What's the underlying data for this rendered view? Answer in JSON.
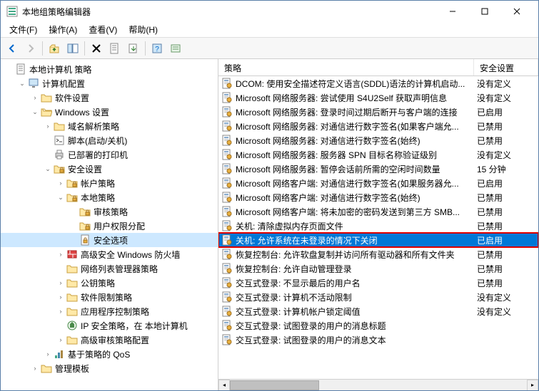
{
  "window": {
    "title": "本地组策略编辑器"
  },
  "menu": {
    "file": "文件(F)",
    "action": "操作(A)",
    "view": "查看(V)",
    "help": "帮助(H)"
  },
  "tree": {
    "root": "本地计算机 策略",
    "computer_config": "计算机配置",
    "software": "软件设置",
    "windows": "Windows 设置",
    "dns": "域名解析策略",
    "scripts": "脚本(启动/关机)",
    "printers": "已部署的打印机",
    "security": "安全设置",
    "account": "帐户策略",
    "local": "本地策略",
    "audit": "审核策略",
    "rights": "用户权限分配",
    "options": "安全选项",
    "firewall": "高级安全 Windows 防火墙",
    "netlist": "网络列表管理器策略",
    "pubkey": "公钥策略",
    "softrestrict": "软件限制策略",
    "appctrl": "应用程序控制策略",
    "ipsec": "IP 安全策略，在 本地计算机",
    "advaudit": "高级审核策略配置",
    "qos": "基于策略的 QoS",
    "admin": "管理模板"
  },
  "list": {
    "col_policy": "策略",
    "col_setting": "安全设置",
    "rows": [
      {
        "name": "DCOM: 使用安全描述符定义语言(SDDL)语法的计算机启动...",
        "val": "没有定义"
      },
      {
        "name": "Microsoft 网络服务器: 尝试使用 S4U2Self 获取声明信息",
        "val": "没有定义"
      },
      {
        "name": "Microsoft 网络服务器: 登录时间过期后断开与客户端的连接",
        "val": "已启用"
      },
      {
        "name": "Microsoft 网络服务器: 对通信进行数字签名(如果客户端允...",
        "val": "已禁用"
      },
      {
        "name": "Microsoft 网络服务器: 对通信进行数字签名(始终)",
        "val": "已禁用"
      },
      {
        "name": "Microsoft 网络服务器: 服务器 SPN 目标名称验证级别",
        "val": "没有定义"
      },
      {
        "name": "Microsoft 网络服务器: 暂停会话前所需的空闲时间数量",
        "val": "15 分钟"
      },
      {
        "name": "Microsoft 网络客户端: 对通信进行数字签名(如果服务器允...",
        "val": "已启用"
      },
      {
        "name": "Microsoft 网络客户端: 对通信进行数字签名(始终)",
        "val": "已禁用"
      },
      {
        "name": "Microsoft 网络客户端: 将未加密的密码发送到第三方 SMB...",
        "val": "已禁用"
      },
      {
        "name": "关机: 清除虚拟内存页面文件",
        "val": "已禁用"
      },
      {
        "name": "关机: 允许系统在未登录的情况下关闭",
        "val": "已启用",
        "selected": true,
        "highlighted": true
      },
      {
        "name": "恢复控制台: 允许软盘复制并访问所有驱动器和所有文件夹",
        "val": "已禁用"
      },
      {
        "name": "恢复控制台: 允许自动管理登录",
        "val": "已禁用"
      },
      {
        "name": "交互式登录: 不显示最后的用户名",
        "val": "已禁用"
      },
      {
        "name": "交互式登录: 计算机不活动限制",
        "val": "没有定义"
      },
      {
        "name": "交互式登录: 计算机帐户锁定阈值",
        "val": "没有定义"
      },
      {
        "name": "交互式登录: 试图登录的用户的消息标题",
        "val": ""
      },
      {
        "name": "交互式登录: 试图登录的用户的消息文本",
        "val": ""
      }
    ]
  }
}
